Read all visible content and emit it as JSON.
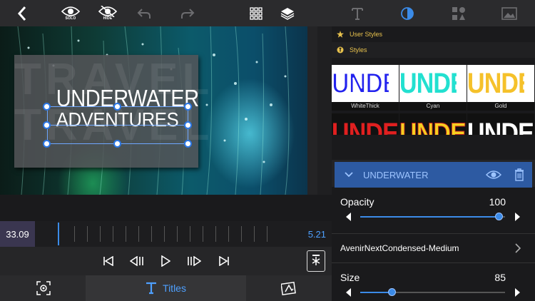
{
  "toolbar": {
    "solo_label": "SOLO",
    "hide_label": "HIDE"
  },
  "preview": {
    "bg_text_1": "TRAVEL",
    "bg_text_2": "TRAVEL",
    "title_line_1": "UNDERWATER",
    "title_line_2": "ADVENTURES"
  },
  "timeline": {
    "current_time": "33.09",
    "end_time": "5.21"
  },
  "bottombar": {
    "titles_label": "Titles"
  },
  "panel": {
    "user_styles_label": "User Styles",
    "styles_label": "Styles",
    "swatches": [
      {
        "text": "UNDE",
        "caption": "WhiteThick"
      },
      {
        "text": "UNDE",
        "caption": "Cyan"
      },
      {
        "text": "UNDE",
        "caption": "Gold"
      }
    ],
    "swatches_row2": [
      {
        "text": "UNDE"
      },
      {
        "text": "UNDE"
      },
      {
        "text": "UNDE"
      }
    ],
    "layer_name": "UNDERWATER",
    "opacity": {
      "label": "Opacity",
      "value": "100",
      "fraction": 0.96
    },
    "font_name": "AvenirNextCondensed-Medium",
    "size": {
      "label": "Size",
      "value": "85",
      "fraction": 0.22
    }
  },
  "colors": {
    "accent": "#3b8be8",
    "layer_bg": "#2d5aa2",
    "section_gold": "#e8c24d",
    "swatch_blue_fill": "#2222ee",
    "swatch_cyan": "#22e0d0",
    "swatch_gold": "#f5c12a"
  }
}
